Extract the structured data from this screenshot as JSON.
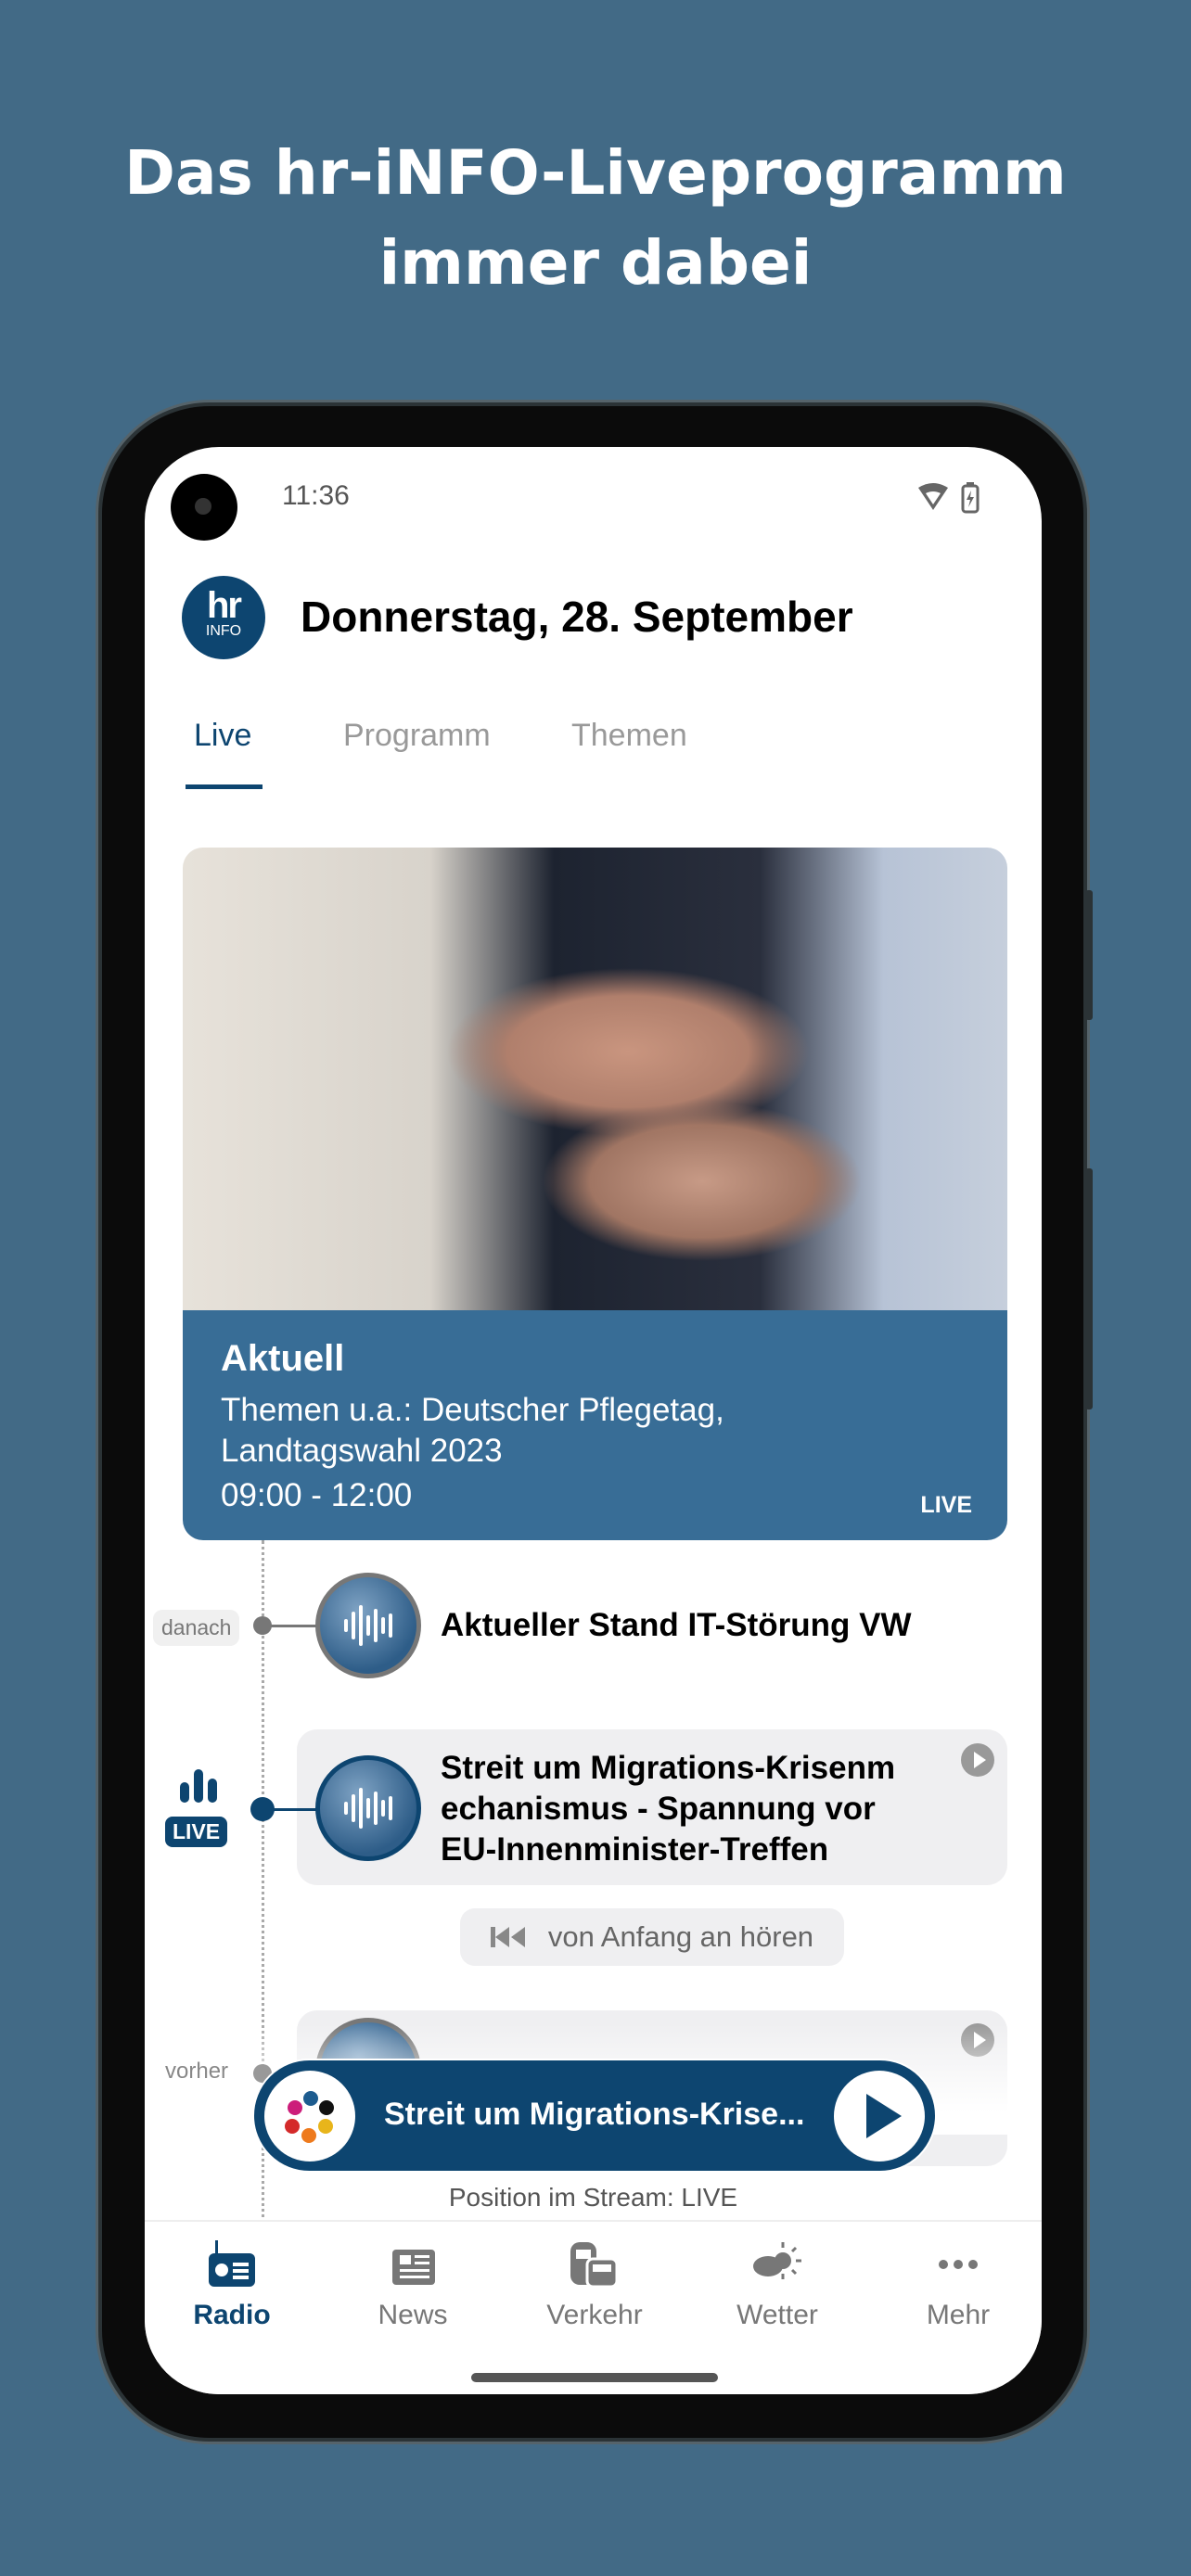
{
  "headline": {
    "line1": "Das hr-iNFO-Liveprogramm",
    "line2": "immer dabei"
  },
  "status": {
    "time": "11:36"
  },
  "header": {
    "logo_top": "hr",
    "logo_bottom": "INFO",
    "title": "Donnerstag, 28. September"
  },
  "tabs": [
    {
      "label": "Live",
      "active": true
    },
    {
      "label": "Programm"
    },
    {
      "label": "Themen"
    }
  ],
  "hero": {
    "title": "Aktuell",
    "subtitle": "Themen u.a.: Deutscher Pflegetag, Landtagswahl 2023",
    "time": "09:00 - 12:00",
    "badge": "LIVE"
  },
  "timeline": {
    "next": {
      "label": "danach",
      "title": "Aktueller Stand IT-Störung VW"
    },
    "live": {
      "label": "LIVE",
      "title": "Streit um Migrations-Krisenm echanismus - Spannung vor EU-Innenminister-Treffen"
    },
    "restart_label": "von Anfang an hören",
    "previous": {
      "label": "vorher"
    }
  },
  "player": {
    "title": "Streit um Migrations-Krise...",
    "position": "Position im Stream: LIVE"
  },
  "nav": [
    {
      "label": "Radio",
      "icon": "radio-icon",
      "active": true
    },
    {
      "label": "News",
      "icon": "newspaper-icon"
    },
    {
      "label": "Verkehr",
      "icon": "traffic-icon"
    },
    {
      "label": "Wetter",
      "icon": "weather-icon"
    },
    {
      "label": "Mehr",
      "icon": "more-icon"
    }
  ],
  "colors": {
    "background": "#426a86",
    "brand": "#0d4570",
    "hero_panel": "#386d96"
  }
}
